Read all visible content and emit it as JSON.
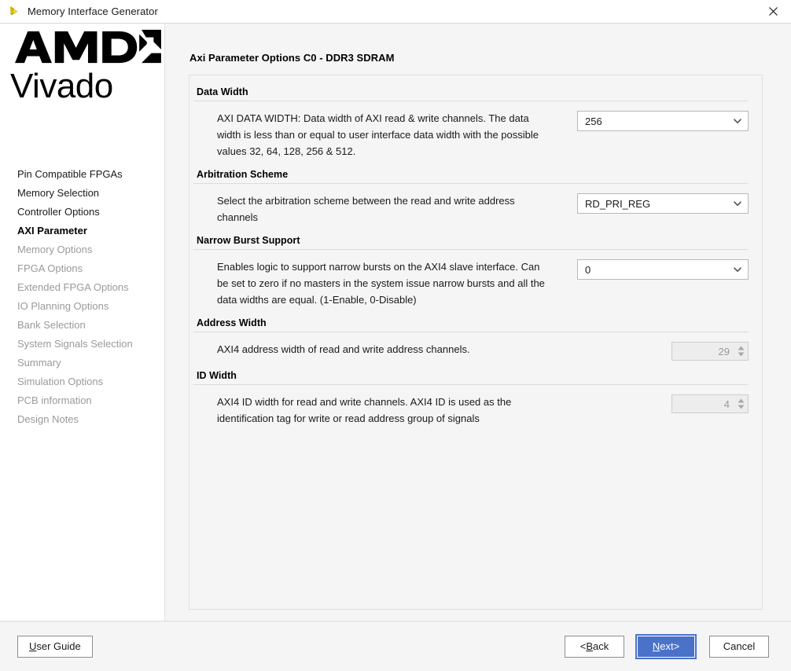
{
  "window": {
    "title": "Memory Interface Generator",
    "icon": "vivado-logo-icon",
    "close_label": "✕"
  },
  "sidebar": {
    "brand_top": "AMD",
    "brand_bottom": "Vivado",
    "items": [
      {
        "label": "Pin Compatible FPGAs",
        "state": "enabled"
      },
      {
        "label": "Memory Selection",
        "state": "enabled"
      },
      {
        "label": "Controller Options",
        "state": "enabled"
      },
      {
        "label": "AXI Parameter",
        "state": "active"
      },
      {
        "label": "Memory Options",
        "state": "disabled"
      },
      {
        "label": "FPGA Options",
        "state": "disabled"
      },
      {
        "label": "Extended FPGA Options",
        "state": "disabled"
      },
      {
        "label": "IO Planning Options",
        "state": "disabled"
      },
      {
        "label": "Bank Selection",
        "state": "disabled"
      },
      {
        "label": "System Signals Selection",
        "state": "disabled"
      },
      {
        "label": "Summary",
        "state": "disabled"
      },
      {
        "label": "Simulation Options",
        "state": "disabled"
      },
      {
        "label": "PCB information",
        "state": "disabled"
      },
      {
        "label": "Design Notes",
        "state": "disabled"
      }
    ]
  },
  "content": {
    "title": "Axi Parameter Options C0 - DDR3 SDRAM",
    "sections": [
      {
        "header": "Data Width",
        "description": "AXI DATA WIDTH: Data width of AXI read & write channels. The data width is less than or equal to user interface data width with the possible values 32, 64, 128, 256 & 512.",
        "control": "combo",
        "value": "256"
      },
      {
        "header": "Arbitration Scheme",
        "description": "Select the arbitration scheme between the read and write address channels",
        "control": "combo",
        "value": "RD_PRI_REG"
      },
      {
        "header": "Narrow Burst Support",
        "description": "Enables logic to support narrow bursts on the AXI4 slave interface. Can be set to zero if no masters in the system issue narrow bursts and all the data widths are equal. (1-Enable, 0-Disable)",
        "control": "combo",
        "value": "0"
      },
      {
        "header": "Address Width",
        "description": "AXI4 address width of read and write address channels.",
        "control": "spinner",
        "value": "29",
        "disabled": true
      },
      {
        "header": "ID Width",
        "description": "AXI4 ID width for read and write channels. AXI4 ID is used as the identification tag for write or read address group of signals",
        "control": "spinner",
        "value": "4",
        "disabled": true
      }
    ]
  },
  "footer": {
    "user_guide": {
      "prefix": "U",
      "rest": "ser Guide"
    },
    "back": {
      "prefix": "< ",
      "accel": "B",
      "rest": "ack"
    },
    "next": {
      "accel": "N",
      "rest": "ext",
      "suffix": " >"
    },
    "cancel": "Cancel"
  },
  "colors": {
    "accent": "#4a72c8",
    "panel_bg": "#f5f5f5",
    "field_bg": "#ffffff",
    "disabled_text": "#9a9a9a"
  }
}
